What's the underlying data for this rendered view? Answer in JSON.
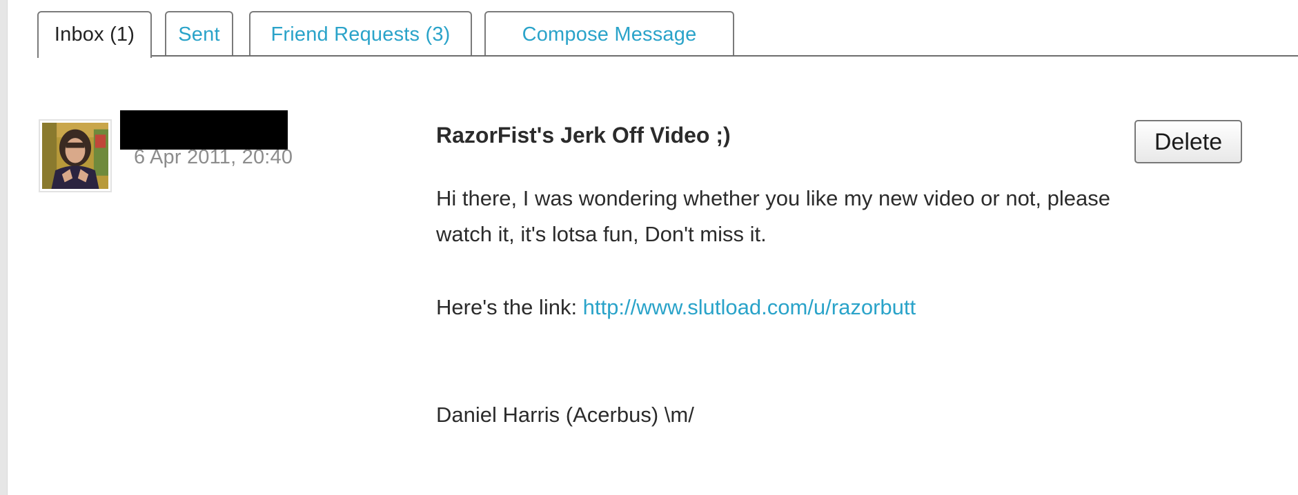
{
  "tabs": [
    {
      "label": "Inbox (1)",
      "active": true
    },
    {
      "label": "Sent",
      "active": false
    },
    {
      "label": "Friend Requests (3)",
      "active": false
    },
    {
      "label": "Compose Message",
      "active": false
    }
  ],
  "message": {
    "timestamp": "6 Apr 2011, 20:40",
    "subject": "RazorFist's Jerk Off Video ;)",
    "delete_label": "Delete",
    "body_line1": "Hi there, I was wondering whether you like my new video or not, please",
    "body_line2": "watch it, it's lotsa fun, Don't miss it.",
    "link_prefix": "Here's the link: ",
    "link_text": "http://www.slutload.com/u/razorbutt",
    "signature": "Daniel Harris (Acerbus) \\m/"
  },
  "colors": {
    "link": "#2aa3c9",
    "text": "#2b2b2b",
    "muted": "#8c8c8c",
    "redaction": "#000000"
  },
  "icons": {
    "avatar": "user-avatar-photo"
  }
}
